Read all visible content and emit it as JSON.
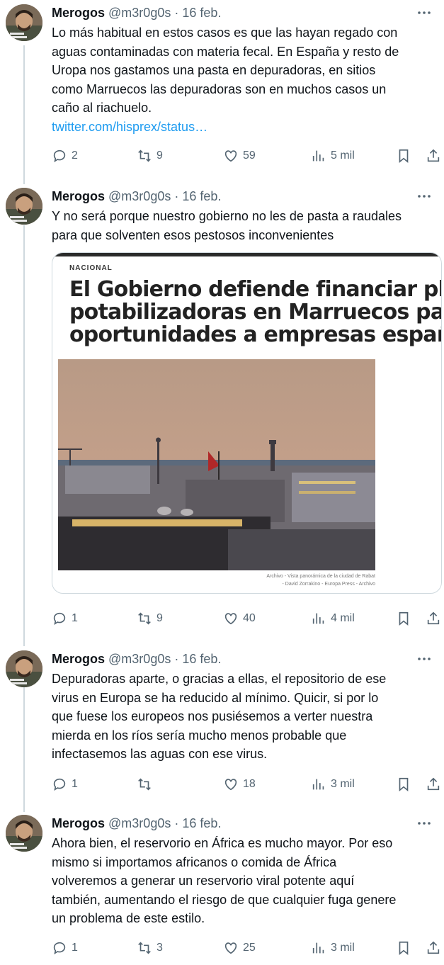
{
  "tweets": [
    {
      "name": "Merogos",
      "handle": "@m3r0g0s",
      "dot": "·",
      "date": "16 feb.",
      "lines": [
        "Lo más habitual en estos casos es que las hayan regado con",
        "aguas contaminadas con materia fecal. En España y resto de",
        "Uropa nos gastamos una pasta en depuradoras, en sitios",
        "como Marruecos las depuradoras son en muchos casos un",
        "caño al riachuelo."
      ],
      "link": "twitter.com/hisprex/status…",
      "stats": {
        "replies": "2",
        "retweets": "9",
        "likes": "59",
        "views": "5 mil"
      }
    },
    {
      "name": "Merogos",
      "handle": "@m3r0g0s",
      "dot": "·",
      "date": "16 feb.",
      "lines": [
        "Y no será porque nuestro gobierno no les de pasta a raudales",
        "para que solventen esos pestosos inconvenientes"
      ],
      "card": {
        "section": "NACIONAL",
        "title_lines": [
          "El Gobierno defiende financiar plantas",
          "potabilizadoras en Marruecos para abrir",
          "oportunidades a empresas españolas"
        ],
        "caption_lines": [
          "Archivo - Vista panorámica de la ciudad de Rabat",
          "- David Zorrakino - Europa Press - Archivo"
        ]
      },
      "stats": {
        "replies": "1",
        "retweets": "9",
        "likes": "40",
        "views": "4 mil"
      }
    },
    {
      "name": "Merogos",
      "handle": "@m3r0g0s",
      "dot": "·",
      "date": "16 feb.",
      "lines": [
        "Depuradoras aparte, o gracias a ellas, el repositorio de ese",
        "virus en Europa se ha reducido al mínimo. Quicir, si por lo",
        "que fuese los europeos nos pusiésemos a verter nuestra",
        "mierda en los ríos sería mucho menos probable que",
        "infectasemos las aguas con ese virus."
      ],
      "stats": {
        "replies": "1",
        "retweets": "",
        "likes": "18",
        "views": "3 mil"
      }
    },
    {
      "name": "Merogos",
      "handle": "@m3r0g0s",
      "dot": "·",
      "date": "16 feb.",
      "lines": [
        "Ahora bien, el reservorio en África es mucho mayor. Por eso",
        "mismo si importamos africanos o comida de África",
        "volveremos a generar un reservorio viral potente aquí",
        "también, aumentando el riesgo de que cualquier fuga genere",
        "un problema de este estilo."
      ],
      "stats": {
        "replies": "1",
        "retweets": "3",
        "likes": "25",
        "views": "3 mil"
      }
    }
  ],
  "icons": {
    "more": "more-horizontal-icon",
    "reply": "reply-icon",
    "retweet": "retweet-icon",
    "like": "heart-icon",
    "views": "views-icon",
    "bookmark": "bookmark-icon",
    "share": "share-icon"
  },
  "colors": {
    "link": "#1d9bf0",
    "secondary": "#536471",
    "thread_line": "#cfd9de"
  }
}
